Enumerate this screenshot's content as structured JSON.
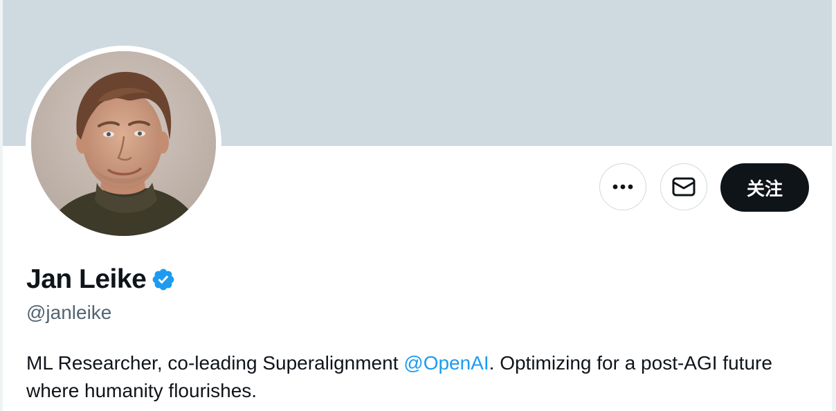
{
  "profile": {
    "display_name": "Jan Leike",
    "handle": "@janleike",
    "verified": true,
    "bio": {
      "before_mention": "ML Researcher, co-leading Superalignment ",
      "mention": "@OpenAI",
      "after_mention": ". Optimizing for a post-AGI future where humanity flourishes."
    }
  },
  "actions": {
    "more_icon": "more-horizontal-icon",
    "message_icon": "envelope-icon",
    "follow_label": "关注"
  },
  "colors": {
    "banner": "#cfd9e0",
    "follow_button": "#0f1419",
    "mention": "#1d9bf0",
    "verified_badge": "#1d9bf0",
    "secondary_text": "#536471"
  }
}
